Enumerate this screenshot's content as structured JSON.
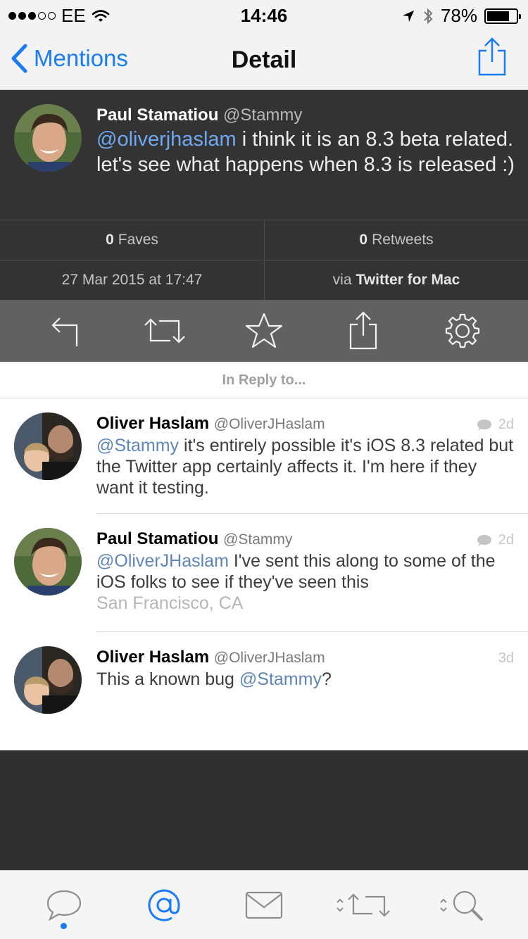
{
  "status_bar": {
    "carrier": "EE",
    "time": "14:46",
    "battery_percent": "78%",
    "battery_level": 0.78,
    "signal_bars_filled": 3,
    "signal_bars_total": 5
  },
  "nav": {
    "back_label": "Mentions",
    "title": "Detail",
    "accent": "#1a7cf5"
  },
  "main_tweet": {
    "name": "Paul Stamatiou",
    "handle": "@Stammy",
    "mention": "@oliverjhaslam",
    "text": " i think it is an 8.3 beta related. let's see what happens when 8.3 is released :)",
    "faves_count": "0",
    "faves_label": "Faves",
    "retweets_count": "0",
    "retweets_label": "Retweets",
    "timestamp": "27 Mar 2015 at 17:47",
    "via_prefix": "via",
    "client": "Twitter for Mac"
  },
  "actions": [
    "reply-icon",
    "retweet-icon",
    "star-icon",
    "share-icon",
    "gear-icon"
  ],
  "reply_header": "In Reply to...",
  "replies": [
    {
      "name": "Oliver Haslam",
      "handle": "@OliverJHaslam",
      "time": "2d",
      "has_conversation_icon": true,
      "mention": "@Stammy",
      "text": " it's entirely possible it's iOS 8.3 related but the Twitter app certainly affects it. I'm here if they want it testing."
    },
    {
      "name": "Paul Stamatiou",
      "handle": "@Stammy",
      "time": "2d",
      "has_conversation_icon": true,
      "mention": "@OliverJHaslam",
      "text": " I've sent this along to some of the iOS folks to see if they've seen this",
      "location": "San Francisco, CA"
    },
    {
      "name": "Oliver Haslam",
      "handle": "@OliverJHaslam",
      "time": "3d",
      "has_conversation_icon": false,
      "text_before": "This a known bug ",
      "mention": "@Stammy",
      "text_after": "?"
    }
  ],
  "tabs": [
    "timeline-icon",
    "mentions-icon",
    "messages-icon",
    "retweets-icon",
    "search-icon"
  ],
  "active_tab": 0
}
